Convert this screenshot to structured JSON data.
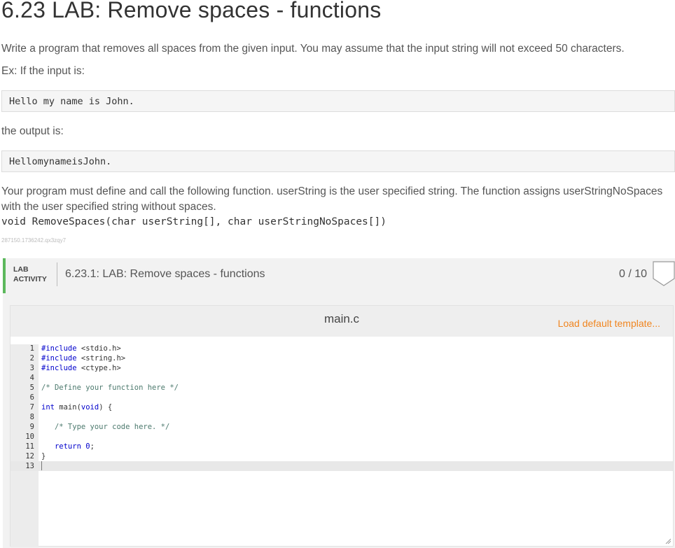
{
  "page": {
    "title": "6.23 LAB: Remove spaces - functions",
    "intro": "Write a program that removes all spaces from the given input. You may assume that the input string will not exceed 50 characters.",
    "example_label": "Ex: If the input is:",
    "example_input": "Hello my name is John.",
    "output_label": "the output is:",
    "example_output": "HellomynameisJohn.",
    "description_line1": "Your program must define and call the following function. userString is the user specified string. The function assigns userStringNoSpaces",
    "description_line2": "with the user specified string without spaces.",
    "function_signature": "void RemoveSpaces(char userString[], char userStringNoSpaces[])",
    "tag": "287150.1736242.qx3zqy7"
  },
  "lab": {
    "label_line1": "LAB",
    "label_line2": "ACTIVITY",
    "title": "6.23.1: LAB: Remove spaces - functions",
    "score": "0 / 10",
    "accent_color": "#5cb85c"
  },
  "editor": {
    "file_name": "main.c",
    "load_template_label": "Load default template...",
    "load_color": "#f0851f",
    "lines": [
      {
        "n": "1",
        "code": "#include <stdio.h>"
      },
      {
        "n": "2",
        "code": "#include <string.h>"
      },
      {
        "n": "3",
        "code": "#include <ctype.h>"
      },
      {
        "n": "4",
        "code": ""
      },
      {
        "n": "5",
        "code": "/* Define your function here */"
      },
      {
        "n": "6",
        "code": ""
      },
      {
        "n": "7",
        "code": "int main(void) {"
      },
      {
        "n": "8",
        "code": ""
      },
      {
        "n": "9",
        "code": "   /* Type your code here. */"
      },
      {
        "n": "10",
        "code": ""
      },
      {
        "n": "11",
        "code": "   return 0;"
      },
      {
        "n": "12",
        "code": "}"
      },
      {
        "n": "13",
        "code": ""
      }
    ]
  }
}
